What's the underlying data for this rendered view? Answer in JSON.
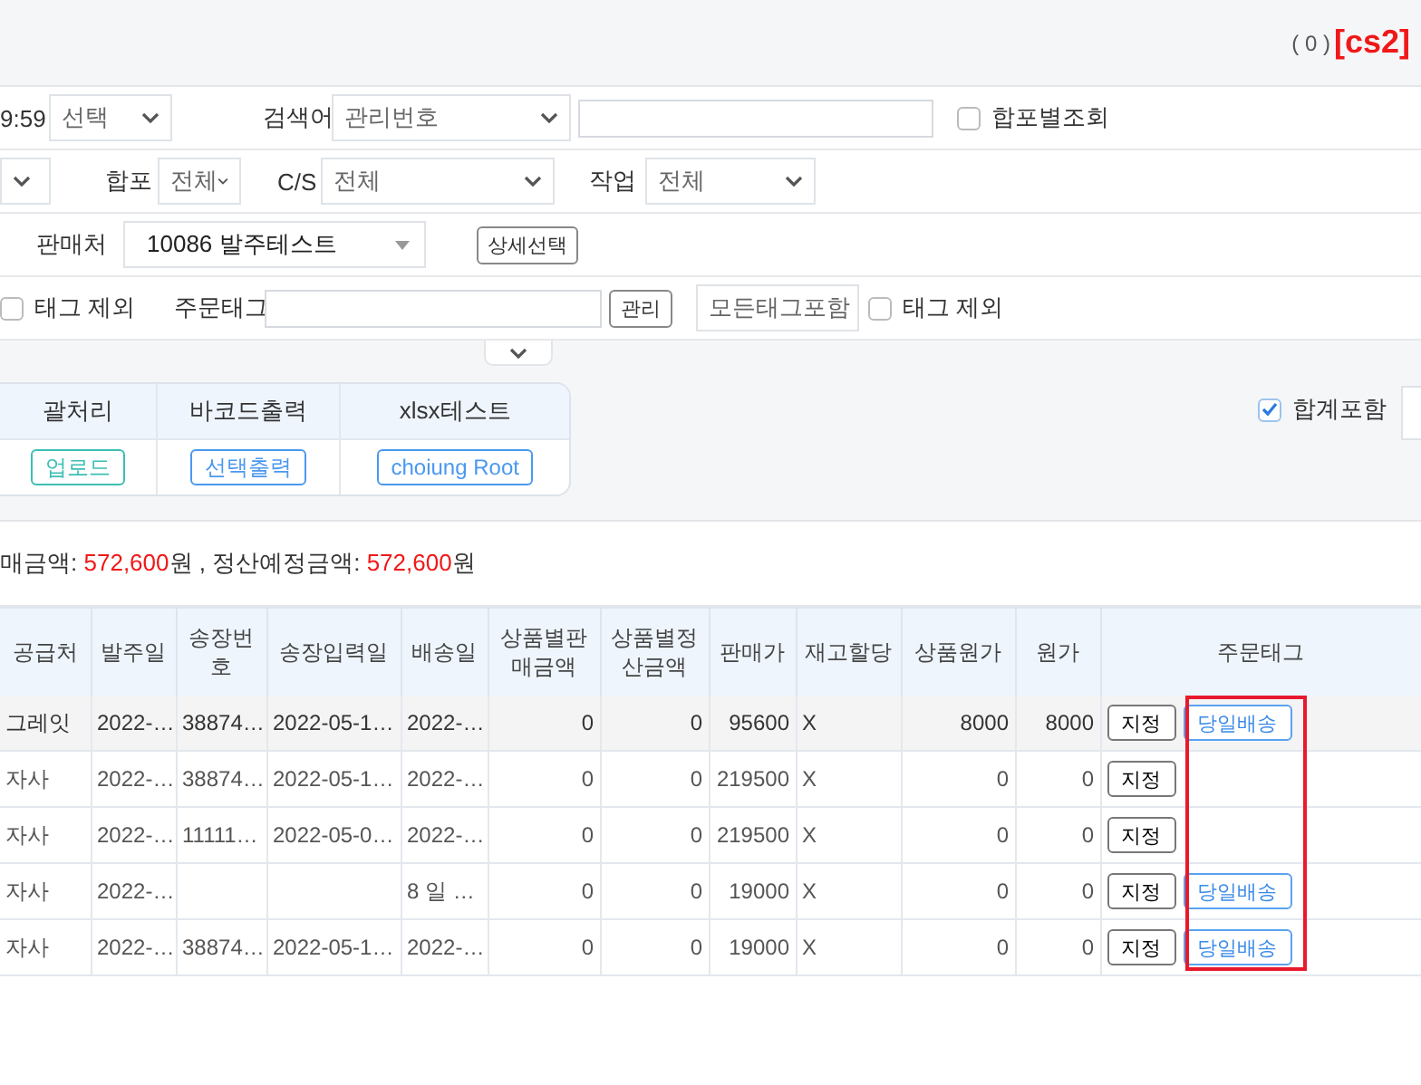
{
  "header": {
    "count": "( 0 )",
    "code": "[cs2]"
  },
  "filters": [
    [
      {
        "kind": "text",
        "text": "9:59"
      },
      {
        "kind": "select",
        "value": "선택"
      },
      {
        "kind": "label",
        "text": "검색어"
      },
      {
        "kind": "select",
        "value": "관리번호"
      },
      {
        "kind": "input"
      },
      {
        "kind": "checkbox",
        "text": "합포별조회",
        "checked": false
      }
    ],
    [
      {
        "kind": "select"
      },
      {
        "kind": "label",
        "text": "합포"
      },
      {
        "kind": "select",
        "value": "전체"
      },
      {
        "kind": "label",
        "text": "C/S"
      },
      {
        "kind": "select",
        "value": "전체"
      },
      {
        "kind": "label",
        "text": "작업"
      },
      {
        "kind": "select",
        "value": "전체"
      }
    ],
    [
      {
        "kind": "label",
        "text": "판매처"
      },
      {
        "kind": "combo",
        "value": "10086 발주테스트"
      },
      {
        "kind": "button",
        "text": "상세선택"
      }
    ],
    [
      {
        "kind": "checkbox",
        "text": "태그 제외",
        "checked": false
      },
      {
        "kind": "label",
        "text": "주문태그"
      },
      {
        "kind": "input"
      },
      {
        "kind": "button",
        "text": "관리"
      },
      {
        "kind": "select",
        "value": "모든태그포함"
      },
      {
        "kind": "checkbox",
        "text": "태그 제외",
        "checked": false
      }
    ]
  ],
  "tools": [
    {
      "title": "괄처리",
      "button": "업로드",
      "color": "#3cbfb3"
    },
    {
      "title": "바코드출력",
      "button": "선택출력",
      "color": "#4a98f0"
    },
    {
      "title": "xlsx테스트",
      "button": "choiung Root",
      "color": "#4a98f0"
    }
  ],
  "include_total": {
    "label": "합계포함",
    "checked": true
  },
  "summary": {
    "label1": "매금액:",
    "amount1": "572,600",
    "unit1": "원 , 정산예정금액:",
    "amount2": "572,600",
    "unit2": "원"
  },
  "table": {
    "columns": [
      "공급처",
      "발주일",
      "송장번호",
      "송장입력일",
      "배송일",
      "상품별판매금액",
      "상품별정산금액",
      "판매가",
      "재고할당",
      "상품원가",
      "원가",
      "주문태그"
    ],
    "rows": [
      {
        "selected": true,
        "cells": [
          "그레잇",
          "2022-…",
          "38874…",
          "2022-05-1…",
          "2022-…",
          "0",
          "0",
          "95600",
          "X",
          "8000",
          "8000"
        ],
        "assign": "지정",
        "tag": "당일배송"
      },
      {
        "selected": false,
        "cells": [
          "자사",
          "2022-…",
          "38874…",
          "2022-05-1…",
          "2022-…",
          "0",
          "0",
          "219500",
          "X",
          "0",
          "0"
        ],
        "assign": "지정"
      },
      {
        "selected": false,
        "cells": [
          "자사",
          "2022-…",
          "11111…",
          "2022-05-0…",
          "2022-…",
          "0",
          "0",
          "219500",
          "X",
          "0",
          "0"
        ],
        "assign": "지정"
      },
      {
        "selected": false,
        "cells": [
          "자사",
          "2022-…",
          null,
          null,
          "8 일 …",
          "0",
          "0",
          "19000",
          "X",
          "0",
          "0"
        ],
        "assign": "지정",
        "tag": "당일배송"
      },
      {
        "selected": false,
        "cells": [
          "자사",
          "2022-…",
          "38874…",
          "2022-05-1…",
          "2022-…",
          "0",
          "0",
          "19000",
          "X",
          "0",
          "0"
        ],
        "assign": "지정",
        "tag": "당일배송"
      }
    ]
  }
}
